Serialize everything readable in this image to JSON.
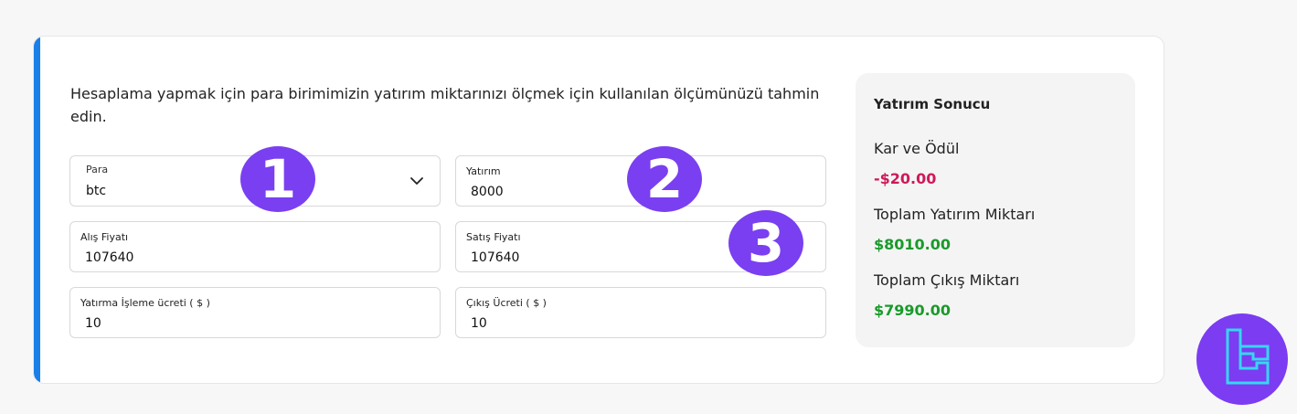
{
  "intro": "Hesaplama yapmak için para birimimizin yatırım miktarınızı ölçmek için kullanılan ölçümünüzü tahmin edin.",
  "fields": {
    "currency": {
      "label": "Para",
      "value": "btc"
    },
    "investment": {
      "label": "Yatırım",
      "value": "8000"
    },
    "buy_price": {
      "label": "Alış Fiyatı",
      "value": "107640"
    },
    "sell_price": {
      "label": "Satış Fiyatı",
      "value": "107640"
    },
    "deposit_fee": {
      "label": "Yatırma İşleme ücreti ( $ )",
      "value": "10"
    },
    "exit_fee": {
      "label": "Çıkış Ücreti ( $ )",
      "value": "10"
    }
  },
  "badges": [
    "1",
    "2",
    "3"
  ],
  "results": {
    "title": "Yatırım Sonucu",
    "profit_label": "Kar ve Ödül",
    "profit_value": "-$20.00",
    "total_investment_label": "Toplam Yatırım Miktarı",
    "total_investment_value": "$8010.00",
    "total_exit_label": "Toplam Çıkış Miktarı",
    "total_exit_value": "$7990.00"
  },
  "colors": {
    "accent": "#1a7fe8",
    "badge": "#7a3ff0",
    "negative": "#d0185a",
    "positive": "#1a9a2a",
    "logo_bg": "#7b3cf2",
    "logo_fg": "#36d7f0"
  },
  "icons": {
    "dropdown": "chevron-down-icon",
    "brand": "brand-logo-icon"
  }
}
